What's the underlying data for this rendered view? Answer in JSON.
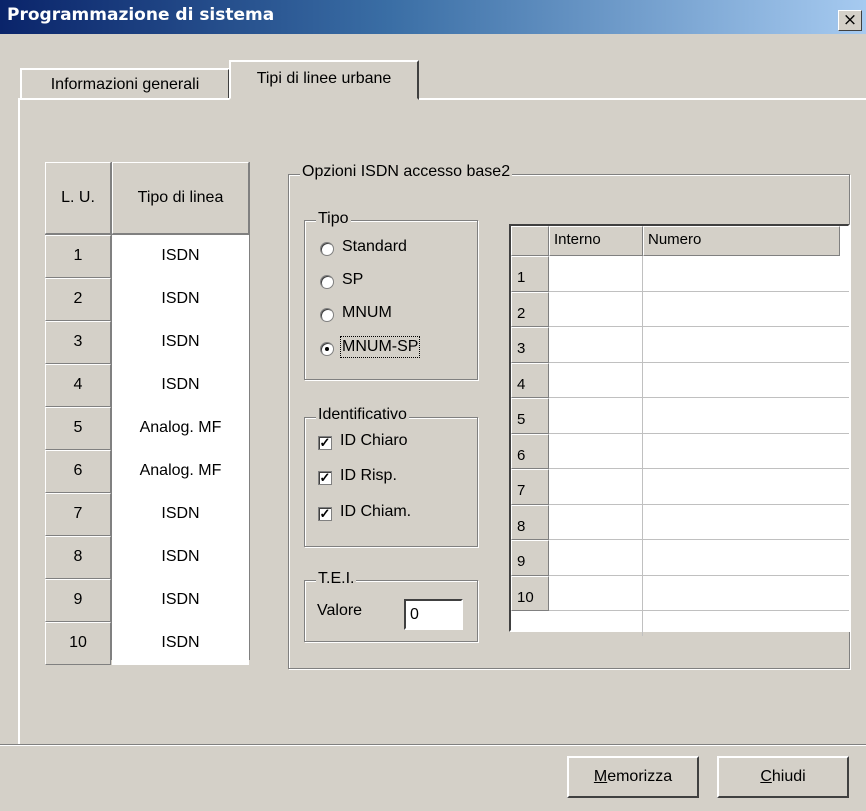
{
  "window": {
    "title": "Programmazione di sistema",
    "close_glyph": "×"
  },
  "tabs": [
    {
      "label": "Informazioni generali",
      "active": false
    },
    {
      "label": "Tipi di linee urbane",
      "active": true
    }
  ],
  "lu_table": {
    "headers": [
      "L. U.",
      "Tipo di linea"
    ],
    "rows": [
      [
        "1",
        "ISDN"
      ],
      [
        "2",
        "ISDN"
      ],
      [
        "3",
        "ISDN"
      ],
      [
        "4",
        "ISDN"
      ],
      [
        "5",
        "Analog. MF"
      ],
      [
        "6",
        "Analog. MF"
      ],
      [
        "7",
        "ISDN"
      ],
      [
        "8",
        "ISDN"
      ],
      [
        "9",
        "ISDN"
      ],
      [
        "10",
        "ISDN"
      ]
    ]
  },
  "isdn": {
    "group_title": "Opzioni ISDN accesso base2",
    "tipo": {
      "title": "Tipo",
      "options": [
        "Standard",
        "SP",
        "MNUM",
        "MNUM-SP"
      ],
      "selected": "MNUM-SP"
    },
    "identificativo": {
      "title": "Identificativo",
      "options": [
        {
          "label": "ID Chiaro",
          "checked": true
        },
        {
          "label": "ID Risp.",
          "checked": true
        },
        {
          "label": "ID Chiam.",
          "checked": true
        }
      ]
    },
    "tei": {
      "title": "T.E.I.",
      "label": "Valore",
      "value": "0"
    }
  },
  "number_grid": {
    "headers": [
      "Interno",
      "Numero"
    ],
    "rows": [
      "1",
      "2",
      "3",
      "4",
      "5",
      "6",
      "7",
      "8",
      "9",
      "10"
    ]
  },
  "buttons": {
    "save": {
      "label": "Memorizza",
      "mnemonic": "M"
    },
    "close": {
      "label": "Chiudi",
      "mnemonic": "C"
    }
  }
}
